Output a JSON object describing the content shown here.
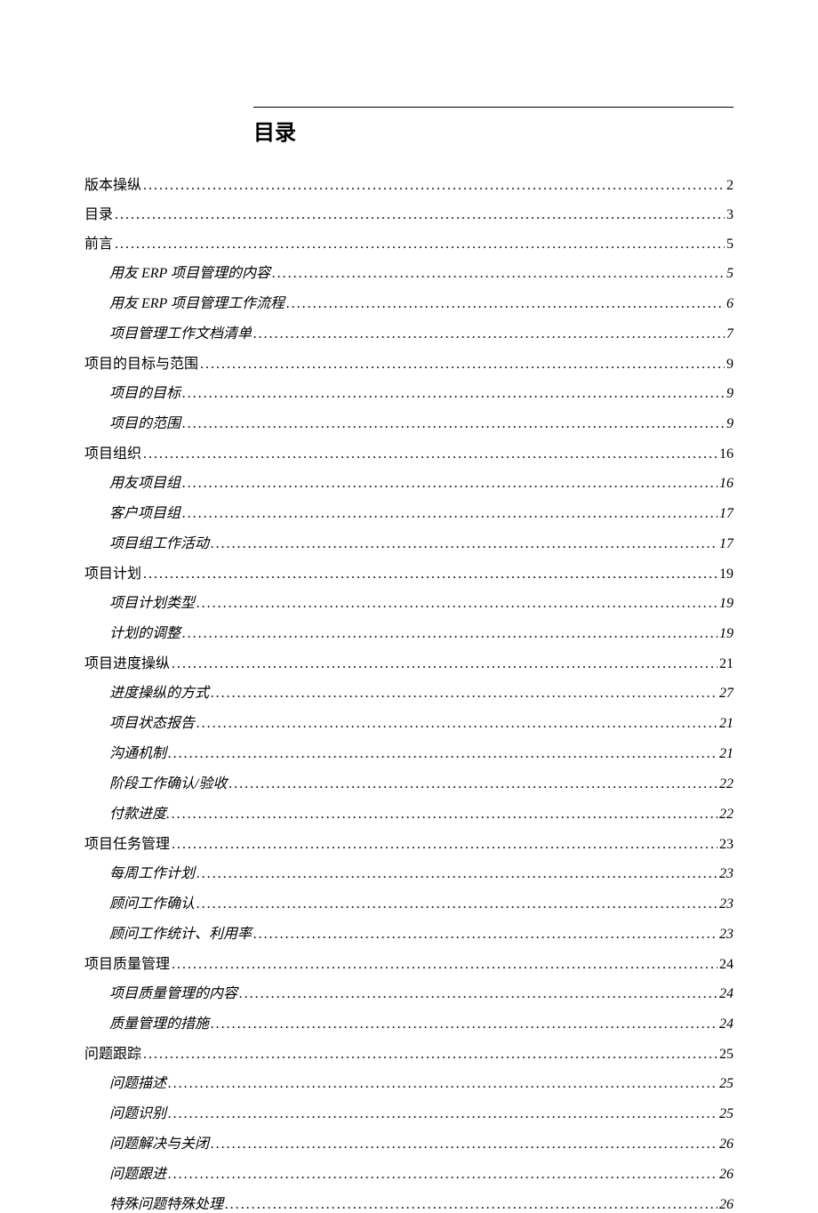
{
  "title": "目录",
  "toc": [
    {
      "level": 1,
      "label": "版本操纵",
      "page": "2"
    },
    {
      "level": 1,
      "label": "目录",
      "page": "3"
    },
    {
      "level": 1,
      "label": "前言",
      "page": "5"
    },
    {
      "level": 2,
      "label": "用友 ERP 项目管理的内容",
      "page": "5"
    },
    {
      "level": 2,
      "label": "用友 ERP 项目管理工作流程",
      "page": "6"
    },
    {
      "level": 2,
      "label": "项目管理工作文档清单",
      "page": "7"
    },
    {
      "level": 1,
      "label": "项目的目标与范围",
      "page": "9"
    },
    {
      "level": 2,
      "label": "项目的目标",
      "page": "9"
    },
    {
      "level": 2,
      "label": "项目的范围",
      "page": "9"
    },
    {
      "level": 1,
      "label": "项目组织",
      "page": "16"
    },
    {
      "level": 2,
      "label": "用友项目组",
      "page": "16"
    },
    {
      "level": 2,
      "label": "客户项目组",
      "page": "17"
    },
    {
      "level": 2,
      "label": "项目组工作活动",
      "page": "17"
    },
    {
      "level": 1,
      "label": "项目计划",
      "page": "19"
    },
    {
      "level": 2,
      "label": "项目计划类型",
      "page": "19"
    },
    {
      "level": 2,
      "label": "计划的调整",
      "page": "19"
    },
    {
      "level": 1,
      "label": "项目进度操纵",
      "page": "21"
    },
    {
      "level": 2,
      "label": "进度操纵的方式",
      "page": "27"
    },
    {
      "level": 2,
      "label": "项目状态报告",
      "page": "21"
    },
    {
      "level": 2,
      "label": "沟通机制",
      "page": "21"
    },
    {
      "level": 2,
      "label": "阶段工作确认/验收",
      "page": "22"
    },
    {
      "level": 2,
      "label": "付款进度.",
      "page": "22"
    },
    {
      "level": 1,
      "label": "项目任务管理",
      "page": "23"
    },
    {
      "level": 2,
      "label": "每周工作计划",
      "page": "23"
    },
    {
      "level": 2,
      "label": "顾问工作确认",
      "page": "23"
    },
    {
      "level": 2,
      "label": "顾问工作统计、利用率",
      "page": "23"
    },
    {
      "level": 1,
      "label": "项目质量管理",
      "page": "24"
    },
    {
      "level": 2,
      "label": "项目质量管理的内容",
      "page": "24"
    },
    {
      "level": 2,
      "label": "质量管理的措施",
      "page": "24"
    },
    {
      "level": 1,
      "label": "问题跟踪",
      "page": "25"
    },
    {
      "level": 2,
      "label": "问题描述",
      "page": "25"
    },
    {
      "level": 2,
      "label": "问题识别",
      "page": "25"
    },
    {
      "level": 2,
      "label": "问题解决与关闭",
      "page": "26"
    },
    {
      "level": 2,
      "label": "问题跟进",
      "page": "26"
    },
    {
      "level": 2,
      "label": "特殊问题特殊处理",
      "page": "26"
    }
  ]
}
